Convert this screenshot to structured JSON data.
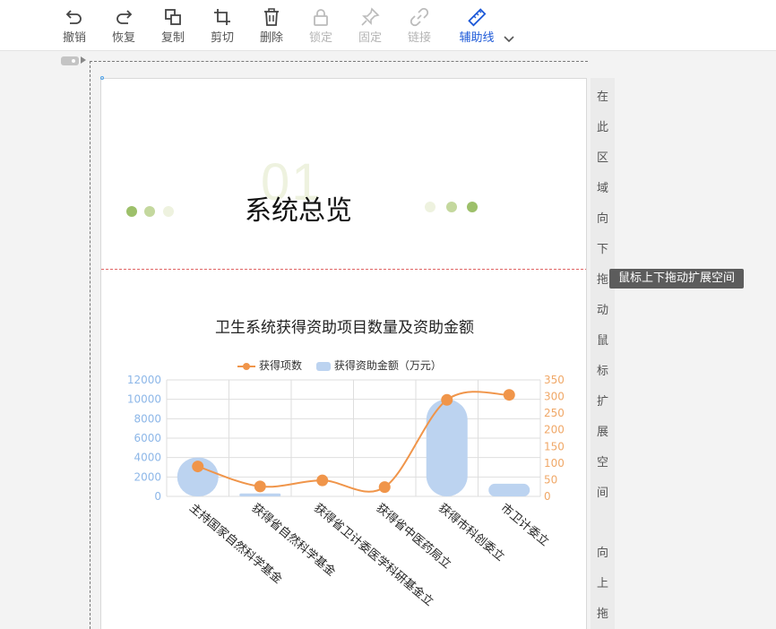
{
  "toolbar": {
    "undo": "撤销",
    "redo": "恢复",
    "copy": "复制",
    "cut": "剪切",
    "delete": "删除",
    "lock": "锁定",
    "pin": "固定",
    "link": "链接",
    "guides": "辅助线"
  },
  "section": {
    "number": "01",
    "title": "系统总览"
  },
  "side_strip": {
    "top_chars": [
      "在",
      "此",
      "区",
      "域",
      "向",
      "下",
      "拖",
      "动",
      "鼠",
      "标",
      "扩",
      "展",
      "空",
      "间"
    ],
    "bottom_chars": [
      "向",
      "上",
      "拖"
    ],
    "tooltip": "鼠标上下拖动扩展空间"
  },
  "colors": {
    "accent": "#1e5ad8",
    "line_series": "#f0954a",
    "bar_series": "#bcd3f0",
    "dot_dark": "#9dc06a",
    "dot_mid": "#c4d89e",
    "dot_light": "#eef2df",
    "divider": "#e06464"
  },
  "chart_data": {
    "type": "bar",
    "title": "卫生系统获得资助项目数量及资助金额",
    "categories": [
      "主持国家自然科学基金",
      "获得省自然科学基金",
      "获得省卫计委医学科研基金立",
      "获得省中医药局立",
      "获得市科创委立",
      "市卫计委立"
    ],
    "series": [
      {
        "name": "获得项数",
        "chart": "line",
        "axis": "right",
        "values": [
          90,
          30,
          48,
          28,
          290,
          305
        ]
      },
      {
        "name": "获得资助金额（万元）",
        "chart": "bar",
        "axis": "left",
        "values": [
          4000,
          300,
          0,
          0,
          10000,
          1300
        ]
      }
    ],
    "y_left": {
      "ticks": [
        "0",
        "2000",
        "4000",
        "6000",
        "8000",
        "10000",
        "12000"
      ],
      "range": [
        0,
        12000
      ]
    },
    "y_right": {
      "ticks": [
        "0",
        "50",
        "100",
        "150",
        "200",
        "250",
        "300",
        "350"
      ],
      "range": [
        0,
        350
      ]
    },
    "grid": true,
    "legend_position": "top"
  }
}
